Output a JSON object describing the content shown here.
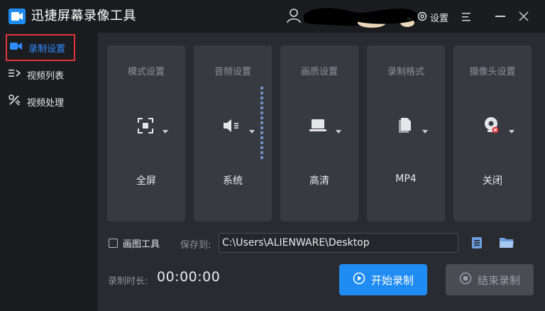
{
  "app": {
    "title": "迅捷屏幕录像工具",
    "logo_icon": "video-camera-icon",
    "accent_color": "#1f8cf3"
  },
  "titlebar": {
    "user_icon": "user-icon",
    "settings_label": "设置",
    "settings_icon": "gear-icon",
    "menu_icon": "hamburger-icon",
    "minimize_icon": "minimize-icon",
    "close_icon": "close-icon"
  },
  "sidebar": {
    "items": [
      {
        "label": "录制设置",
        "icon": "video-camera-icon",
        "active": true
      },
      {
        "label": "视频列表",
        "icon": "list-icon",
        "active": false
      },
      {
        "label": "视频处理",
        "icon": "tools-icon",
        "active": false
      }
    ]
  },
  "cards": [
    {
      "header": "模式设置",
      "value": "全屏",
      "icon": "fullscreen-icon"
    },
    {
      "header": "音频设置",
      "value": "系统",
      "icon": "speaker-icon"
    },
    {
      "header": "画质设置",
      "value": "高清",
      "icon": "monitor-icon"
    },
    {
      "header": "录制格式",
      "value": "MP4",
      "icon": "file-icon"
    },
    {
      "header": "摄像头设置",
      "value": "关闭",
      "icon": "webcam-icon"
    }
  ],
  "bottom": {
    "draw_tool_label": "画图工具",
    "draw_tool_checked": false,
    "save_to_label": "保存到:",
    "save_path": "C:\\Users\\ALIENWARE\\Desktop",
    "list_icon": "list-icon",
    "folder_icon": "folder-icon",
    "duration_label": "录制时长:",
    "duration_value": "00:00:00",
    "start_label": "开始录制",
    "stop_label": "结束录制"
  }
}
